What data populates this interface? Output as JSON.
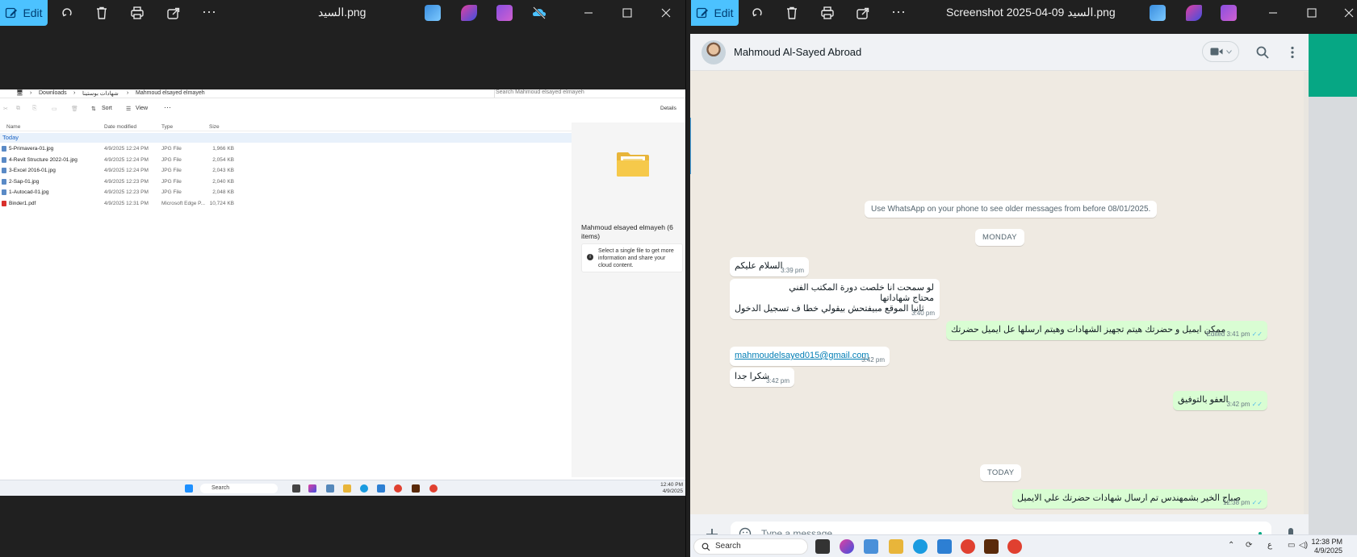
{
  "left_window": {
    "edit_label": "Edit",
    "title": "السيد.png",
    "screenshot": {
      "breadcrumb": [
        "Downloads",
        "شهادات بوستينا",
        "Mahmoud elsayed elmayeh"
      ],
      "search_placeholder": "Search Mahmoud elsayed elmayeh",
      "cmd_sort": "Sort",
      "cmd_view": "View",
      "cmd_more": "···",
      "cmd_details": "Details",
      "columns": [
        "Name",
        "Date modified",
        "Type",
        "Size"
      ],
      "group_label": "Today",
      "files": [
        {
          "name": "5-Primavera-01.jpg",
          "date": "4/9/2025 12:24 PM",
          "type": "JPG File",
          "size": "1,966 KB",
          "kind": "jpg"
        },
        {
          "name": "4-Revit Structure 2022-01.jpg",
          "date": "4/9/2025 12:24 PM",
          "type": "JPG File",
          "size": "2,054 KB",
          "kind": "jpg"
        },
        {
          "name": "3-Excel 2016-01.jpg",
          "date": "4/9/2025 12:24 PM",
          "type": "JPG File",
          "size": "2,043 KB",
          "kind": "jpg"
        },
        {
          "name": "2-Sap-01.jpg",
          "date": "4/9/2025 12:23 PM",
          "type": "JPG File",
          "size": "2,040 KB",
          "kind": "jpg"
        },
        {
          "name": "1-Autocad-01.jpg",
          "date": "4/9/2025 12:23 PM",
          "type": "JPG File",
          "size": "2,048 KB",
          "kind": "jpg"
        },
        {
          "name": "Binder1.pdf",
          "date": "4/9/2025 12:31 PM",
          "type": "Microsoft Edge P...",
          "size": "10,724 KB",
          "kind": "pdf"
        }
      ],
      "details_title": "Mahmoud elsayed elmayeh (6 items)",
      "details_info": "Select a single file to get more information and share your cloud content.",
      "taskbar_search": "Search",
      "clock_time": "12:40 PM",
      "clock_date": "4/9/2025"
    }
  },
  "right_window": {
    "edit_label": "Edit",
    "title": "Screenshot 2025-04-09 السيد.png",
    "whatsapp": {
      "contact_name": "Mahmoud Al-Sayed Abroad",
      "older_notice": "Use WhatsApp on your phone to see older messages from before 08/01/2025.",
      "day_monday": "MONDAY",
      "day_today": "TODAY",
      "messages": [
        {
          "dir": "in",
          "lines": [
            "السلام عليكم"
          ],
          "time": "3:39 pm"
        },
        {
          "dir": "in",
          "lines": [
            "لو سمحت انا خلصت دورة المكتب الفني",
            "محتاج شهاداتها",
            "ثانيا الموقع مبيفتحش بيقولي خطا ف تسجيل الدخول"
          ],
          "time": "3:40 pm"
        },
        {
          "dir": "out",
          "lines": [
            "ممكن ايميل و حضرتك هيتم تجهيز الشهادات وهيتم ارسلها عل ايميل حضرتك"
          ],
          "time": "Edited 3:41 pm"
        },
        {
          "dir": "in",
          "lines": [
            "mahmoudelsayed015@gmail.com"
          ],
          "time": "3:42 pm"
        },
        {
          "dir": "in",
          "lines": [
            "شكرا جدا"
          ],
          "time": "3:42 pm"
        },
        {
          "dir": "out",
          "lines": [
            "العفو بالتوفيق"
          ],
          "time": "3:42 pm"
        },
        {
          "dir": "out",
          "lines": [
            "صباح الخير بشمهندس تم ارسال شهادات حضرتك علي الايميل"
          ],
          "time": "12:38 pm"
        }
      ],
      "composer_placeholder": "Type a message"
    },
    "taskbar": {
      "search_label": "Search",
      "clock_time": "12:38 PM",
      "clock_date": "4/9/2025",
      "lang": "ع"
    }
  },
  "colors": {
    "accent": "#4cc2ff",
    "wa_green": "#06a784",
    "bubble_out": "#d9fdd3",
    "read_ticks": "#53bdeb"
  }
}
